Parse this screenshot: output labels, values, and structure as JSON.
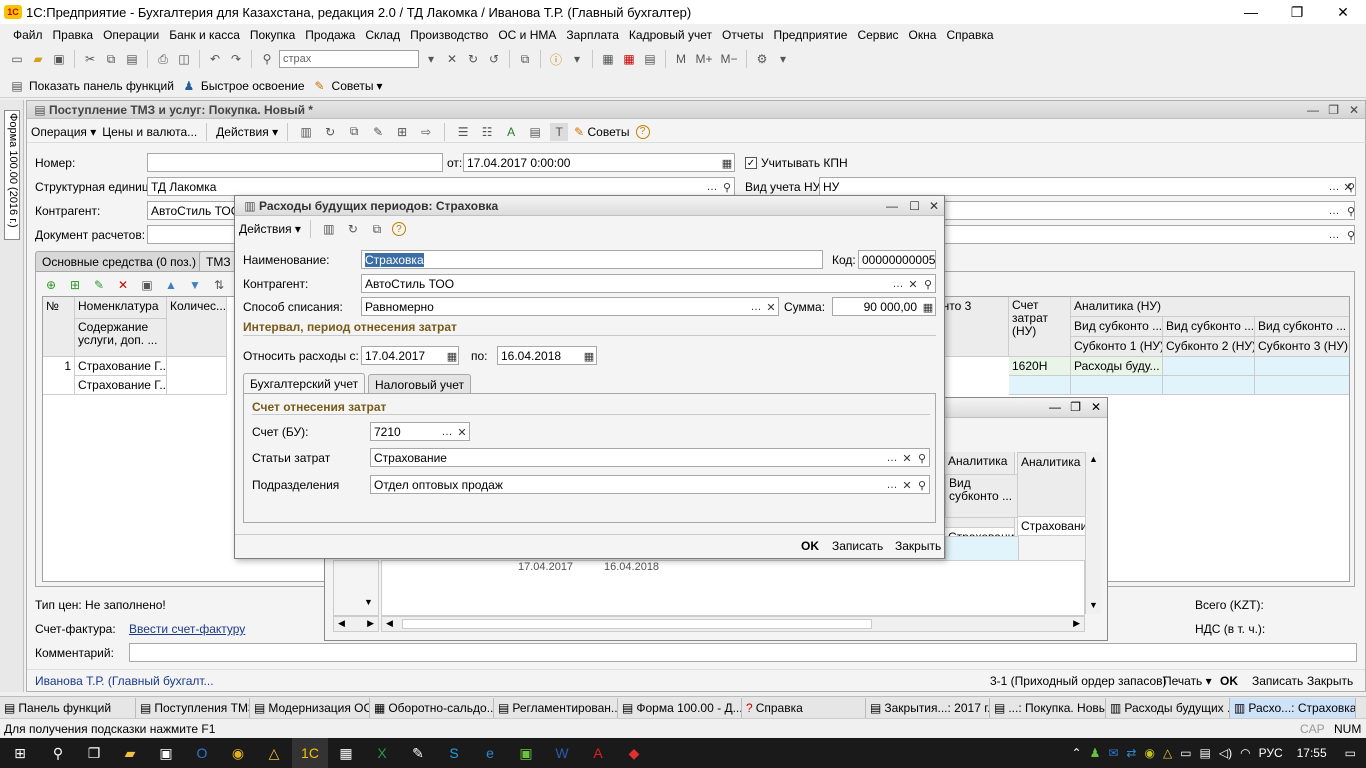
{
  "app": {
    "title": "1С:Предприятие - Бухгалтерия для Казахстана, редакция 2.0 / ТД Лакомка / Иванова Т.Р. (Главный бухгалтер)",
    "logo": "1С"
  },
  "menu": [
    "Файл",
    "Правка",
    "Операции",
    "Банк и касса",
    "Покупка",
    "Продажа",
    "Склад",
    "Производство",
    "ОС и НМА",
    "Зарплата",
    "Кадровый учет",
    "Отчеты",
    "Предприятие",
    "Сервис",
    "Окна",
    "Справка"
  ],
  "toolbar": {
    "search_value": "страх"
  },
  "toolbar2": {
    "show_panel": "Показать панель функций",
    "quick_learn": "Быстрое освоение",
    "tips": "Советы"
  },
  "side": {
    "form_label": "Форма 100.00 (2016 г.)"
  },
  "doc": {
    "title": "Поступление ТМЗ и услуг: Покупка. Новый *",
    "toolbar": {
      "operation": "Операция",
      "prices": "Цены и валюта...",
      "actions": "Действия",
      "tips": "Советы"
    },
    "number_label": "Номер:",
    "from_label": "от:",
    "date_value": "17.04.2017  0:00:00",
    "kpn_label": "Учитывать КПН",
    "unit_label": "Структурная единица:",
    "unit_value": "ТД Лакомка",
    "nu_label": "Вид учета НУ:",
    "nu_value": "НУ",
    "contractor_label": "Контрагент:",
    "contractor_value": "АвтоСтиль ТОО",
    "settlement_label": "Документ расчетов:",
    "tabs": [
      "Основные средства (0 поз.)",
      "ТМЗ"
    ],
    "grid": {
      "col_no": "№",
      "col_nom": "Номенклатура",
      "col_qty": "Количес...",
      "col_content": "Содержание услуги, доп. ...",
      "row_no": "1",
      "row_nom": "Страхование Г...",
      "row_content": "Страхование Г...",
      "col_account": "Счет затрат (НУ)",
      "col_analytics": "Аналитика (НУ)",
      "col_kind1": "Вид субконто ...",
      "col_kind2": "Вид субконто ...",
      "col_kind3": "Вид субконто ...",
      "col_sub1": "Субконто 1 (НУ)",
      "col_sub2": "Субконто 2 (НУ)",
      "col_sub3": "Субконто 3 (НУ)",
      "partial_col": "онто 3",
      "row_account": "1620Н",
      "row_analytics": "Расходы буду..."
    },
    "price_type": "Тип цен: Не заполнено!",
    "invoice_label": "Счет-фактура:",
    "invoice_link": "Ввести счет-фактуру",
    "comment_label": "Комментарий:",
    "total_label": "Всего (KZT):",
    "vat_label": "НДС (в т. ч.):",
    "footer_user": "Иванова Т.Р. (Главный бухгалт...",
    "footer_order": "3-1 (Приходный ордер запасов)",
    "print": "Печать",
    "ok": "OK",
    "save": "Записать",
    "close": "Закрыть"
  },
  "bgwin": {
    "col_analytics": "Аналитика",
    "col_kind": "Вид субконто ...",
    "row_value": "Страхование",
    "date_from": "17.04.2017",
    "date_to": "16.04.2018"
  },
  "modal": {
    "title": "Расходы будущих периодов: Страховка",
    "actions": "Действия",
    "name_label": "Наименование:",
    "name_value": "Страховка",
    "code_label": "Код:",
    "code_value": "00000000005",
    "contractor_label": "Контрагент:",
    "contractor_value": "АвтоСтиль ТОО",
    "method_label": "Способ списания:",
    "method_value": "Равномерно",
    "sum_label": "Сумма:",
    "sum_value": "90 000,00",
    "interval_title": "Интервал, период отнесения затрат",
    "from_label": "Относить расходы с:",
    "from_value": "17.04.2017",
    "to_label": "по:",
    "to_value": "16.04.2018",
    "tab_bu": "Бухгалтерский учет",
    "tab_nu": "Налоговый учет",
    "account_title": "Счет отнесения затрат",
    "account_label": "Счет (БУ):",
    "account_value": "7210",
    "costs_label": "Статьи затрат",
    "costs_value": "Страхование",
    "dept_label": "Подразделения",
    "dept_value": "Отдел оптовых продаж",
    "ok": "OK",
    "save": "Записать",
    "close": "Закрыть"
  },
  "taskbar": [
    "Панель функций",
    "Поступления ТМЗ...",
    "Модернизация ОС",
    "Оборотно-сальдо...",
    "Регламентирован...",
    "Форма 100.00 - Д...",
    "Справка",
    "Закрытия...: 2017 г.",
    "...: Покупка. Новы...",
    "Расходы будущих ...",
    "Расхо...: Страховка"
  ],
  "status": {
    "hint": "Для получения подсказки нажмите F1",
    "cap": "CAP",
    "num": "NUM"
  },
  "tray": {
    "lang": "РУС",
    "time": "17:55"
  }
}
